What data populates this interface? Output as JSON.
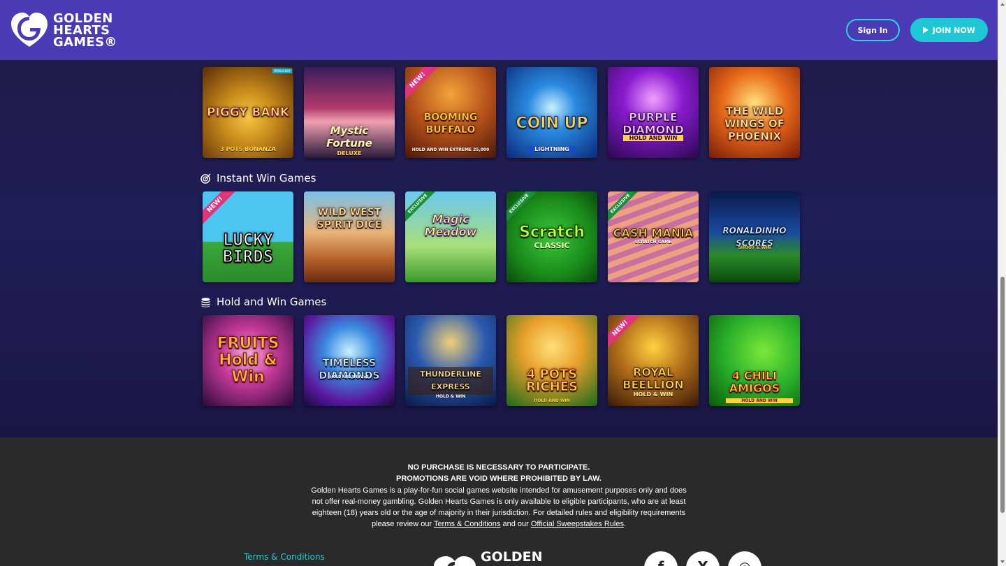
{
  "brand": {
    "name_line1": "GOLDEN",
    "name_line2": "HEARTS",
    "name_line3": "GAMES®"
  },
  "header": {
    "signin_label": "Sign In",
    "join_label": "JOIN NOW"
  },
  "sections": {
    "instant": {
      "title": "Instant Win Games",
      "icon": "target-icon"
    },
    "hold": {
      "title": "Hold and Win Games",
      "icon": "coin-stack-icon"
    }
  },
  "rows": {
    "top": [
      {
        "title": "PIGGY BANK",
        "sub": "3 POTS BONANZA",
        "tag": "BONUS BUY",
        "ribbon": ""
      },
      {
        "title": "Mystic Fortune",
        "sub": "DELUXE",
        "tag": "",
        "ribbon": ""
      },
      {
        "title": "BOOMING BUFFALO",
        "sub": "HOLD AND WIN EXTREME 25,000",
        "tag": "",
        "ribbon": "NEW!"
      },
      {
        "title": "COIN UP",
        "sub": "LIGHTNING",
        "tag": "",
        "ribbon": ""
      },
      {
        "title": "PURPLE DIAMOND",
        "sub": "HOLD AND WIN",
        "tag": "",
        "ribbon": ""
      },
      {
        "title": "THE WILD WINGS OF PHOENIX",
        "sub": "",
        "tag": "",
        "ribbon": ""
      }
    ],
    "instant": [
      {
        "title": "LUCKY BIRDS",
        "sub": "",
        "ribbon": "NEW!"
      },
      {
        "title": "WILD WEST SPIRIT DICE",
        "sub": "",
        "ribbon": ""
      },
      {
        "title": "Magic Meadow",
        "sub": "",
        "ribbon": "EXCLUSIVE"
      },
      {
        "title": "Scratch",
        "sub": "CLASSIC",
        "ribbon": "EXCLUSIVE"
      },
      {
        "title": "CASH MANIA",
        "sub": "SCRATCH GAME",
        "ribbon": "EXCLUSIVE"
      },
      {
        "title": "RONALDINHO SCORES",
        "sub": "SHOOT & WIN",
        "ribbon": ""
      }
    ],
    "hold": [
      {
        "title": "FRUITS Hold & Win",
        "sub": "",
        "ribbon": ""
      },
      {
        "title": "TIMELESS DIAMONDS",
        "sub": "HOLD AND WIN 3x3",
        "ribbon": ""
      },
      {
        "title": "THUNDERLINE EXPRESS",
        "sub": "HOLD & WIN",
        "ribbon": ""
      },
      {
        "title": "4 POTS RICHES",
        "sub": "HOLD AND WIN",
        "ribbon": ""
      },
      {
        "title": "ROYAL BEELLION",
        "sub": "HOLD & WIN",
        "ribbon": "NEW!"
      },
      {
        "title": "4 CHILI AMIGOS",
        "sub": "HOLD AND WIN",
        "ribbon": ""
      }
    ]
  },
  "footer": {
    "line1": "NO PURCHASE IS NECESSARY TO PARTICIPATE.",
    "line2": "PROMOTIONS ARE VOID WHERE PROHIBITED BY LAW.",
    "body": "Golden Hearts Games is a play-for-fun social games website intended for amusement purposes only and does not offer real-money gambling. Golden Hearts Games is only available to eligible participants, who are at least eighteen (18) years old or the age of majority in their jurisdiction. For detailed rules and eligibility requirements please review our",
    "terms_link": "Terms & Conditions",
    "and_text": "and our",
    "rules_link": "Official Sweepstakes Rules",
    "period": ".",
    "terms_nav": "Terms & Conditions",
    "logo_text": "GOLDEN",
    "socials": [
      "facebook-icon",
      "x-icon",
      "instagram-icon"
    ],
    "social_glyphs": [
      "f",
      "X",
      "◎"
    ]
  }
}
